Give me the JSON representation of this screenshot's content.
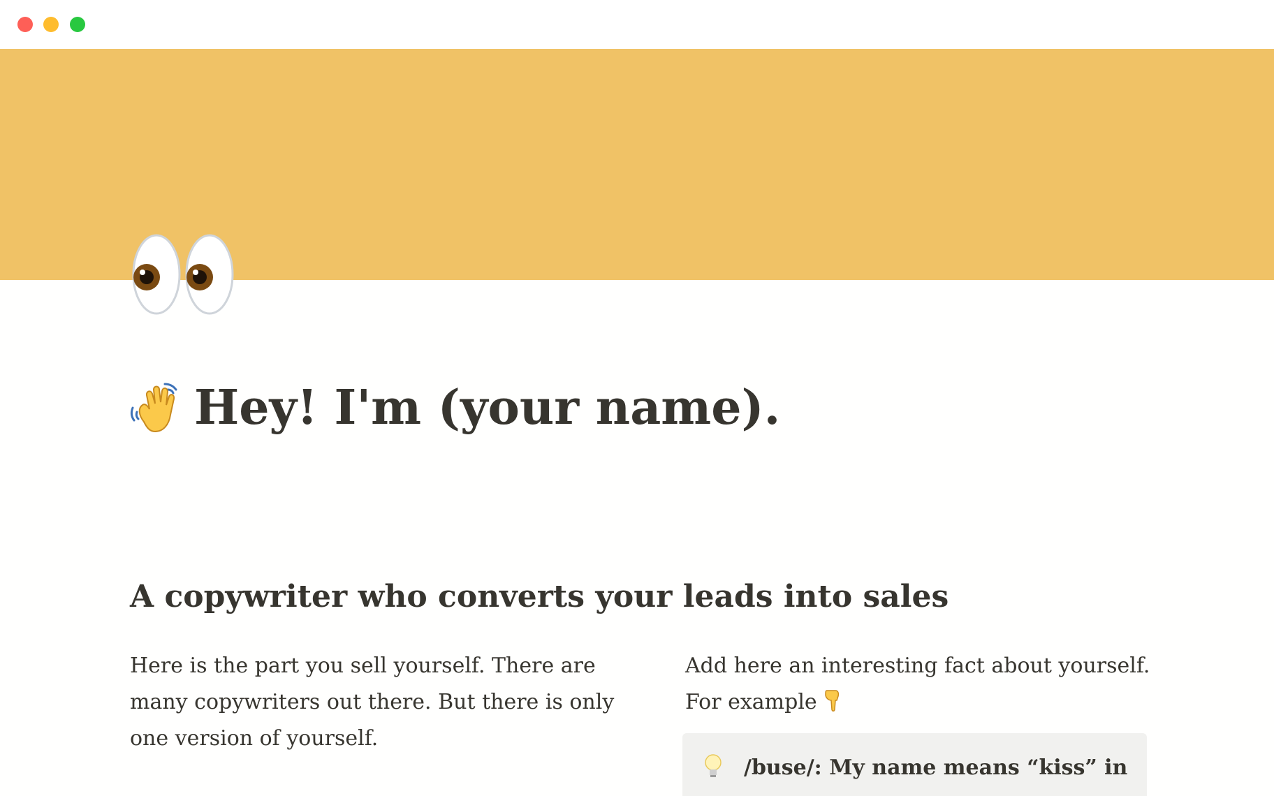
{
  "window": {
    "controls": [
      "close",
      "minimize",
      "maximize"
    ]
  },
  "cover": {
    "color": "#f0c266"
  },
  "page": {
    "icon": "eyes-icon",
    "title_emoji": "waving-hand-icon",
    "title": "Hey! I'm (your name)."
  },
  "section": {
    "heading": "A copywriter who converts your leads into sales",
    "left_paragraph": "Here is the part you sell yourself. There are many copywriters out there. But there is only one version of yourself.",
    "right_paragraph": "Add here an interesting fact about yourself. For example",
    "right_emoji": "pointing-down-icon"
  },
  "callout": {
    "icon": "light-bulb-icon",
    "text": "/buse/: My name means “kiss” in"
  }
}
